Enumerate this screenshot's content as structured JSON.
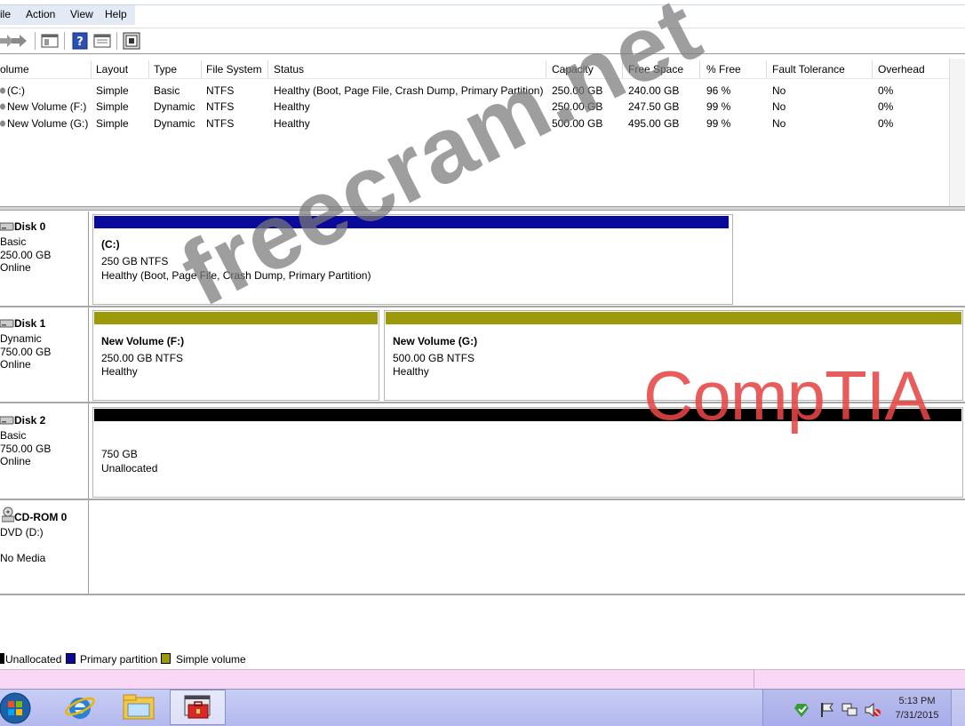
{
  "menu": {
    "file": "ile",
    "action": "Action",
    "view": "View",
    "help": "Help"
  },
  "toolbar": {
    "icons": [
      "back-arrow-icon",
      "forward-arrow-icon",
      "console-tree-icon",
      "help-icon",
      "properties-icon",
      "disk-settings-icon"
    ]
  },
  "volume_list": {
    "columns": [
      "olume",
      "Layout",
      "Type",
      "File System",
      "Status",
      "Capacity",
      "Free Space",
      "% Free",
      "Fault Tolerance",
      "Overhead"
    ],
    "rows": [
      {
        "volume": "(C:)",
        "layout": "Simple",
        "type": "Basic",
        "fs": "NTFS",
        "status": "Healthy (Boot, Page File, Crash Dump, Primary Partition)",
        "capacity": "250.00 GB",
        "free": "240.00 GB",
        "pct": "96 %",
        "fault": "No",
        "overhead": "0%"
      },
      {
        "volume": "New Volume (F:)",
        "layout": "Simple",
        "type": "Dynamic",
        "fs": "NTFS",
        "status": "Healthy",
        "capacity": "250.00 GB",
        "free": "247.50 GB",
        "pct": "99 %",
        "fault": "No",
        "overhead": "0%"
      },
      {
        "volume": "New Volume (G:)",
        "layout": "Simple",
        "type": "Dynamic",
        "fs": "NTFS",
        "status": "Healthy",
        "capacity": "500.00 GB",
        "free": "495.00 GB",
        "pct": "99 %",
        "fault": "No",
        "overhead": "0%"
      }
    ]
  },
  "disks": [
    {
      "name": "Disk 0",
      "type": "Basic",
      "size": "250.00 GB",
      "state": "Online",
      "partitions": [
        {
          "title": "(C:)",
          "line1": "250 GB NTFS",
          "line2": "Healthy (Boot, Page File, Crash Dump, Primary Partition)"
        }
      ]
    },
    {
      "name": "Disk 1",
      "type": "Dynamic",
      "size": "750.00 GB",
      "state": "Online",
      "partitions": [
        {
          "title": "New Volume (F:)",
          "line1": "250.00 GB NTFS",
          "line2": "Healthy"
        },
        {
          "title": "New Volume (G:)",
          "line1": "500.00 GB NTFS",
          "line2": "Healthy"
        }
      ]
    },
    {
      "name": "Disk 2",
      "type": "Basic",
      "size": "750.00 GB",
      "state": "Online",
      "partitions": [
        {
          "title": "",
          "line1": "750 GB",
          "line2": "Unallocated"
        }
      ]
    },
    {
      "name": "CD-ROM 0",
      "type": "DVD (D:)",
      "size": "",
      "state": "No Media",
      "partitions": []
    }
  ],
  "legend": {
    "unallocated": "Unallocated",
    "primary": "Primary partition",
    "simple": "Simple volume"
  },
  "colors": {
    "primary_partition": "#0000a0",
    "simple_volume": "#9c9a0a",
    "unallocated": "#000000"
  },
  "taskbar": {
    "time": "5:13 PM",
    "date": "7/31/2015"
  },
  "watermark": {
    "site": "freecram.net",
    "brand": "CompTIA"
  }
}
